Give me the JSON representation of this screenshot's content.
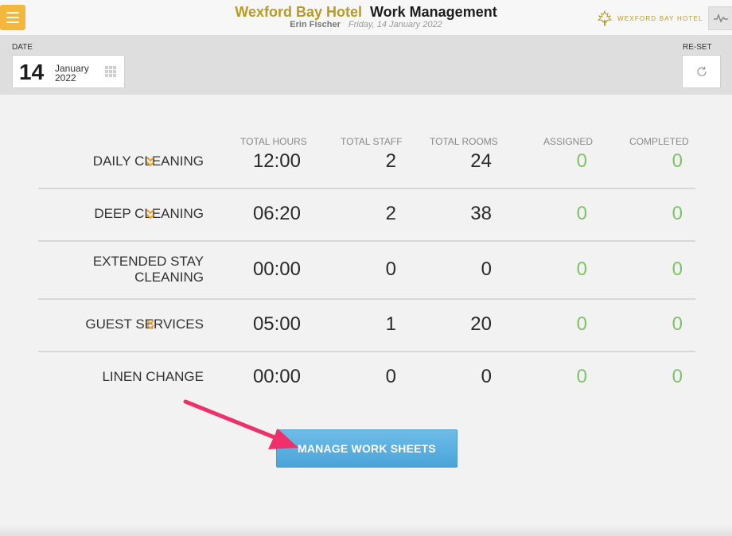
{
  "header": {
    "hotel_name": "Wexford Bay Hotel",
    "app_title": "Work Management",
    "user": "Erin Fischer",
    "date_text": "Friday, 14 January 2022",
    "brand_text": "WEXFORD BAY HOTEL",
    "menu_icon": "hamburger-icon",
    "activity_icon": "activity-icon"
  },
  "datebar": {
    "date_label": "DATE",
    "day": "14",
    "month": "January",
    "year": "2022",
    "calendar_icon": "grid-icon",
    "reset_label": "RE-SET",
    "reset_icon": "refresh-icon"
  },
  "table": {
    "columns": [
      "TOTAL HOURS",
      "TOTAL STAFF",
      "TOTAL ROOMS",
      "ASSIGNED",
      "COMPLETED"
    ],
    "rows": [
      {
        "task": "DAILY CLEANING",
        "expandable": true,
        "hours": "12:00",
        "staff": "2",
        "rooms": "24",
        "assigned": "0",
        "completed": "0"
      },
      {
        "task": "DEEP CLEANING",
        "expandable": true,
        "hours": "06:20",
        "staff": "2",
        "rooms": "38",
        "assigned": "0",
        "completed": "0"
      },
      {
        "task": "EXTENDED STAY CLEANING",
        "task_line1": "EXTENDED STAY",
        "task_line2": "CLEANING",
        "expandable": false,
        "hours": "00:00",
        "staff": "0",
        "rooms": "0",
        "assigned": "0",
        "completed": "0"
      },
      {
        "task": "GUEST SERVICES",
        "expandable": true,
        "hours": "05:00",
        "staff": "1",
        "rooms": "20",
        "assigned": "0",
        "completed": "0"
      },
      {
        "task": "LINEN CHANGE",
        "expandable": false,
        "hours": "00:00",
        "staff": "0",
        "rooms": "0",
        "assigned": "0",
        "completed": "0"
      }
    ]
  },
  "actions": {
    "manage_label": "MANAGE WORK SHEETS"
  },
  "colors": {
    "brand_gold": "#b89b1f",
    "menu_orange": "#f3b73b",
    "expand_orange": "#f0a020",
    "green": "#7ec36a",
    "button_blue": "#5bb0e0",
    "arrow_pink": "#f0306a"
  }
}
